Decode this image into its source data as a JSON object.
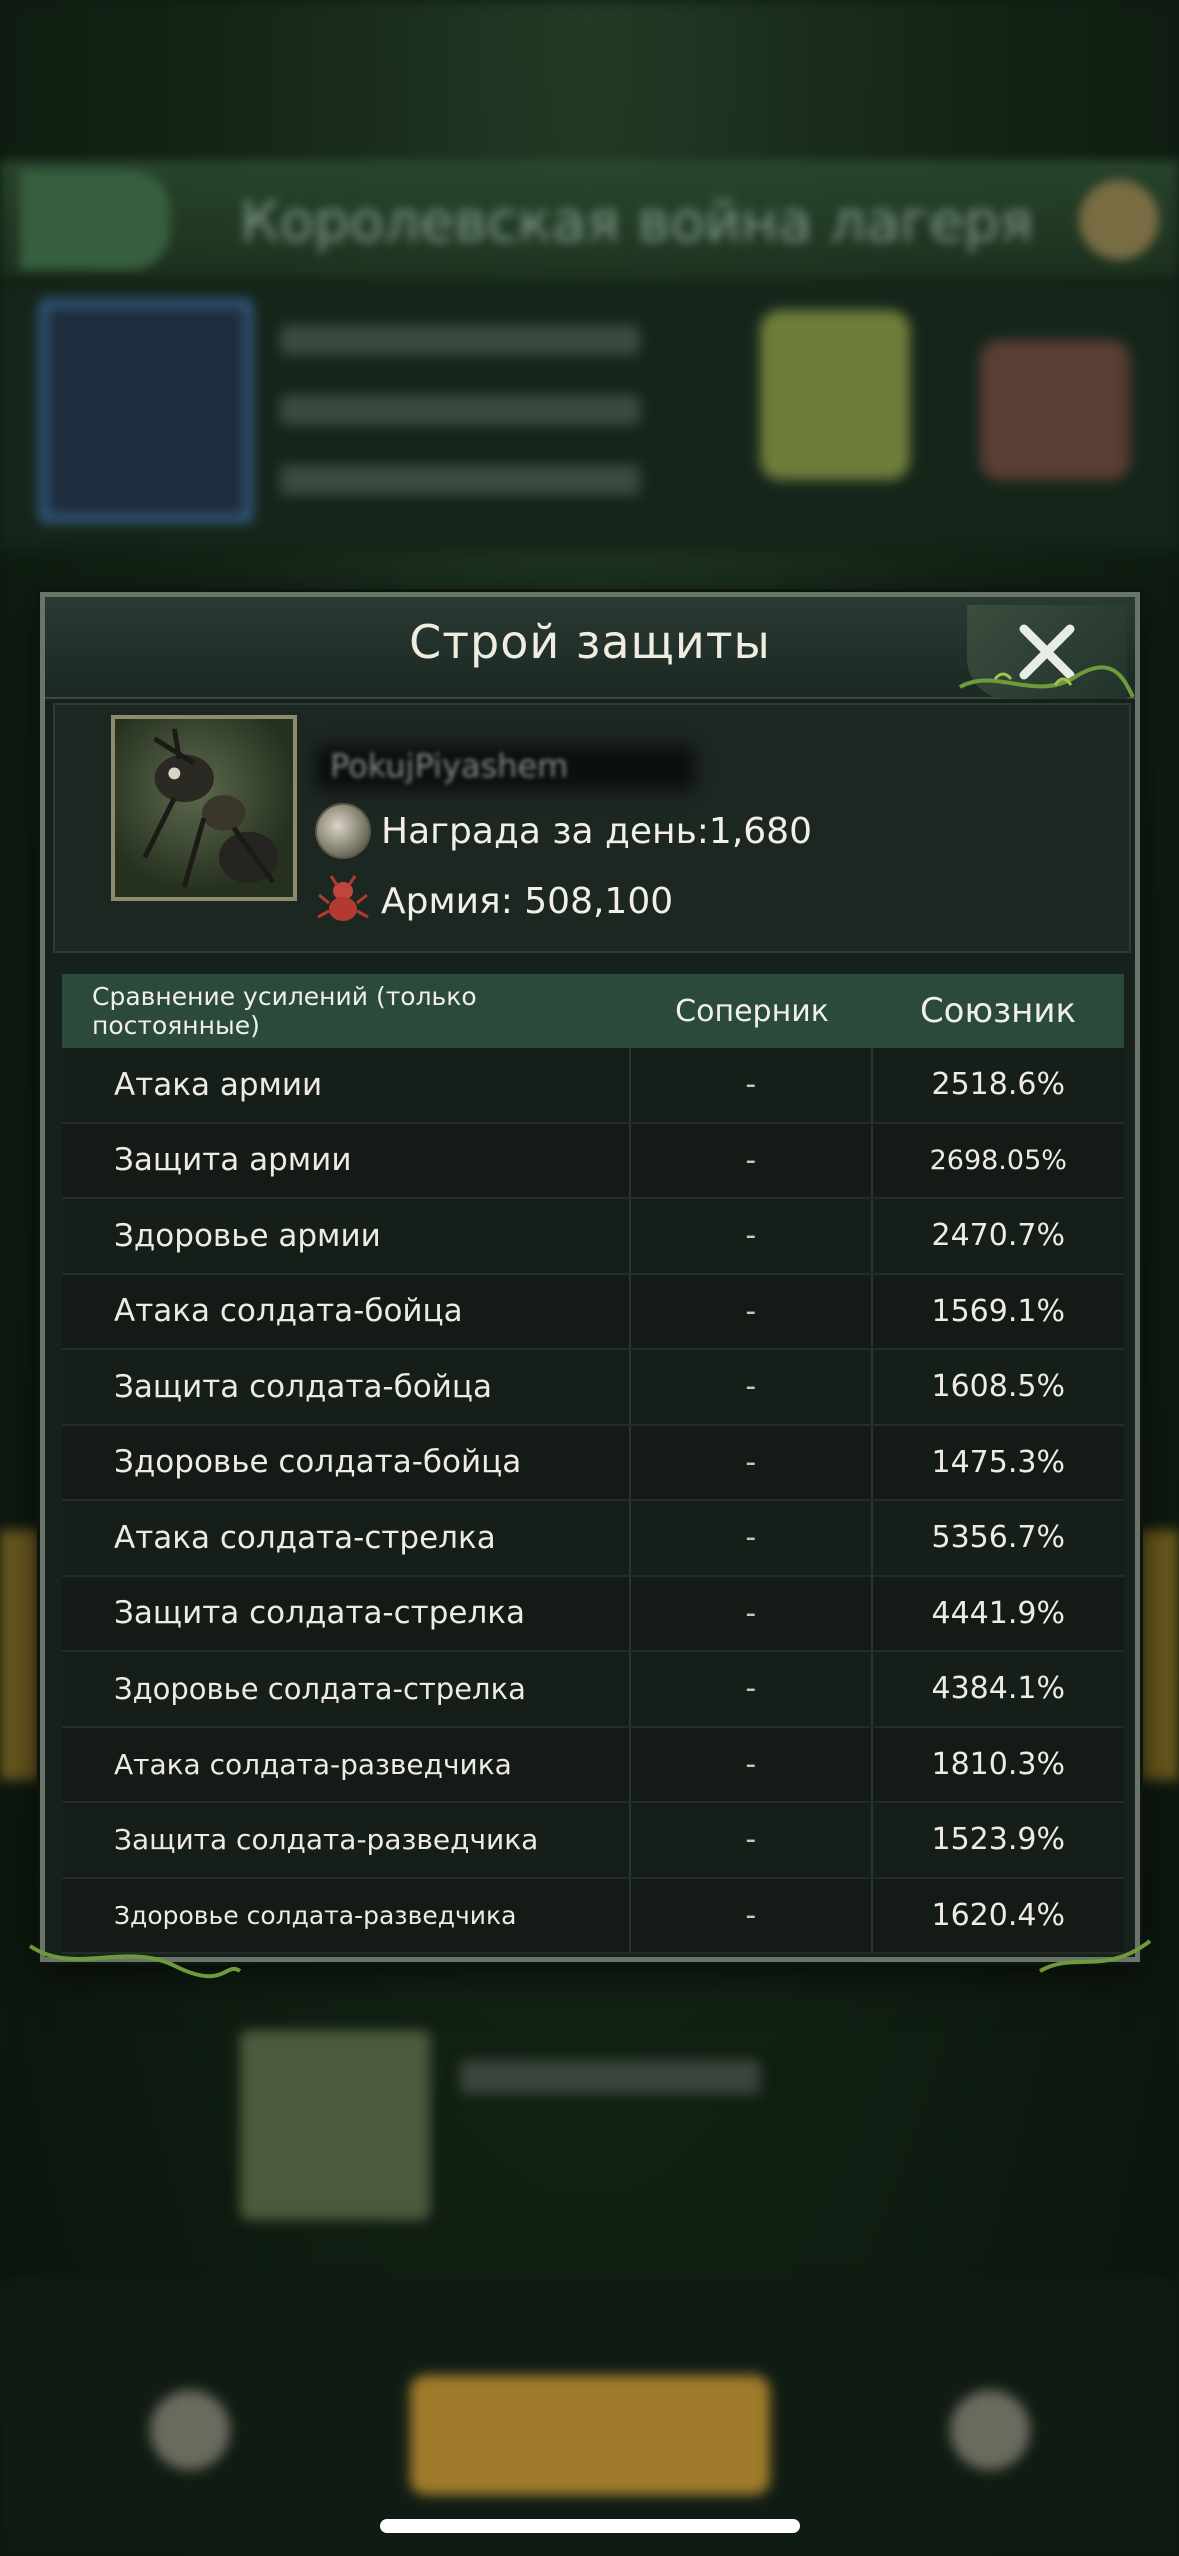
{
  "dialog": {
    "title": "Строй защиты",
    "player": {
      "name": "PokujPiyashem",
      "reward_label": "Награда за день:1,680",
      "army_label": "Армия: 508,100"
    },
    "table": {
      "headers": [
        "Сравнение усилений (только постоянные)",
        "Соперник",
        "Союзник"
      ],
      "rows": [
        {
          "name": "Атака армии",
          "opponent": "-",
          "ally": "2518.6%"
        },
        {
          "name": "Защита армии",
          "opponent": "-",
          "ally": "2698.05%"
        },
        {
          "name": "Здоровье армии",
          "opponent": "-",
          "ally": "2470.7%"
        },
        {
          "name": "Атака солдата-бойца",
          "opponent": "-",
          "ally": "1569.1%"
        },
        {
          "name": "Защита солдата-бойца",
          "opponent": "-",
          "ally": "1608.5%"
        },
        {
          "name": "Здоровье солдата-бойца",
          "opponent": "-",
          "ally": "1475.3%"
        },
        {
          "name": "Атака солдата-стрелка",
          "opponent": "-",
          "ally": "5356.7%"
        },
        {
          "name": "Защита солдата-стрелка",
          "opponent": "-",
          "ally": "4441.9%"
        },
        {
          "name": "Здоровье солдата-стрелка",
          "opponent": "-",
          "ally": "4384.1%"
        },
        {
          "name": "Атака солдата-разведчика",
          "opponent": "-",
          "ally": "1810.3%"
        },
        {
          "name": "Защита солдата-разведчика",
          "opponent": "-",
          "ally": "1523.9%"
        },
        {
          "name": "Здоровье солдата-разведчика",
          "opponent": "-",
          "ally": "1620.4%"
        }
      ]
    }
  },
  "icons": {
    "close": "close-icon",
    "reward": "reward-coin-icon",
    "army": "army-ant-icon",
    "avatar": "ant-avatar"
  },
  "colors": {
    "table_header_bg": "#2b4a3c",
    "dialog_bg": "#17211c",
    "text": "#eeebe2"
  }
}
